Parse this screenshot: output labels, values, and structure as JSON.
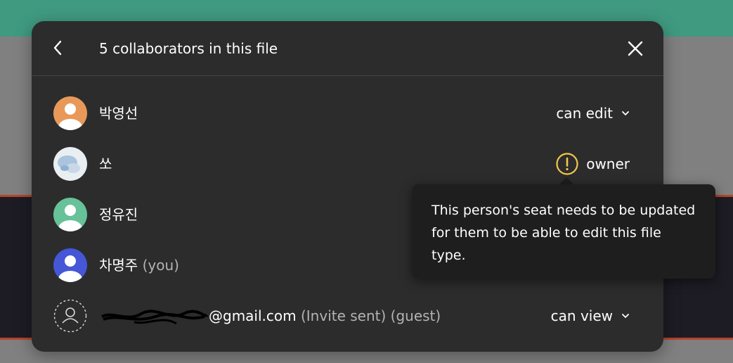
{
  "dialog": {
    "title": "5 collaborators in this file"
  },
  "collaborators": [
    {
      "name": "박영선",
      "permission": "can edit",
      "avatar_color": "#e8995a"
    },
    {
      "name": "쏘",
      "permission": "owner",
      "avatar_icon": "photo-avatar-icon",
      "warning_icon": "exclamation-circle-icon"
    },
    {
      "name": "정유진",
      "avatar_color": "#67c199"
    },
    {
      "name": "차명주",
      "you_label": "(you)",
      "avatar_color": "#4557d6"
    },
    {
      "email_visible": "@gmail.com",
      "invite_meta": "(Invite sent) (guest)",
      "permission": "can view",
      "avatar_icon": "guest-user-icon"
    }
  ],
  "tooltip": {
    "text": "This person's seat needs to be updated for them to be able to edit this file type."
  },
  "colors": {
    "modal_bg": "#2c2c2c",
    "tooltip_bg": "#1e1e1e",
    "warning": "#f2c84b",
    "header_strip": "#3f9a80"
  }
}
